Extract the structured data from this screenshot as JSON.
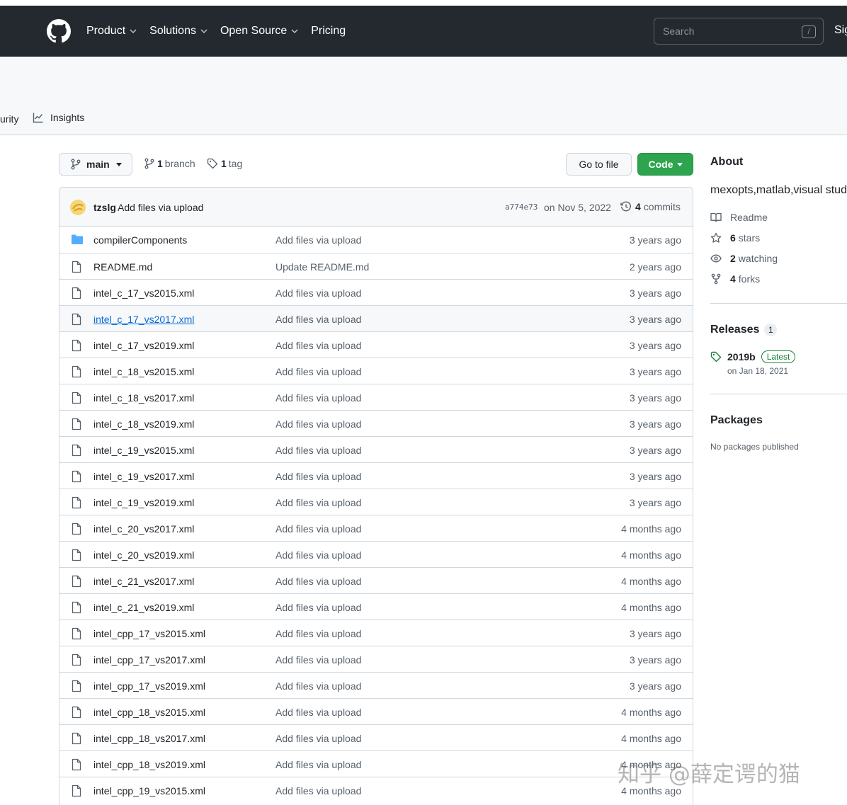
{
  "header": {
    "nav": [
      {
        "label": "Product",
        "has_menu": true
      },
      {
        "label": "Solutions",
        "has_menu": true
      },
      {
        "label": "Open Source",
        "has_menu": true
      },
      {
        "label": "Pricing",
        "has_menu": false
      }
    ],
    "search_placeholder": "Search",
    "search_shortcut": "/",
    "signin_label": "Sig"
  },
  "repo_tabs": {
    "security_partial": "urity",
    "insights": "Insights"
  },
  "toolbar": {
    "branch": "main",
    "branch_count": "1",
    "branch_label": "branch",
    "tag_count": "1",
    "tag_label": "tag",
    "goto_file": "Go to file",
    "code": "Code"
  },
  "latest_commit": {
    "author": "tzslg",
    "message": "Add files via upload",
    "sha": "a774e73",
    "date": "on Nov 5, 2022",
    "commit_count": "4",
    "commit_label": "commits"
  },
  "files": [
    {
      "type": "dir",
      "name": "compilerComponents",
      "message": "Add files via upload",
      "age": "3 years ago"
    },
    {
      "type": "file",
      "name": "README.md",
      "message": "Update README.md",
      "age": "2 years ago"
    },
    {
      "type": "file",
      "name": "intel_c_17_vs2015.xml",
      "message": "Add files via upload",
      "age": "3 years ago"
    },
    {
      "type": "file",
      "name": "intel_c_17_vs2017.xml",
      "message": "Add files via upload",
      "age": "3 years ago",
      "hover": true
    },
    {
      "type": "file",
      "name": "intel_c_17_vs2019.xml",
      "message": "Add files via upload",
      "age": "3 years ago"
    },
    {
      "type": "file",
      "name": "intel_c_18_vs2015.xml",
      "message": "Add files via upload",
      "age": "3 years ago"
    },
    {
      "type": "file",
      "name": "intel_c_18_vs2017.xml",
      "message": "Add files via upload",
      "age": "3 years ago"
    },
    {
      "type": "file",
      "name": "intel_c_18_vs2019.xml",
      "message": "Add files via upload",
      "age": "3 years ago"
    },
    {
      "type": "file",
      "name": "intel_c_19_vs2015.xml",
      "message": "Add files via upload",
      "age": "3 years ago"
    },
    {
      "type": "file",
      "name": "intel_c_19_vs2017.xml",
      "message": "Add files via upload",
      "age": "3 years ago"
    },
    {
      "type": "file",
      "name": "intel_c_19_vs2019.xml",
      "message": "Add files via upload",
      "age": "3 years ago"
    },
    {
      "type": "file",
      "name": "intel_c_20_vs2017.xml",
      "message": "Add files via upload",
      "age": "4 months ago"
    },
    {
      "type": "file",
      "name": "intel_c_20_vs2019.xml",
      "message": "Add files via upload",
      "age": "4 months ago"
    },
    {
      "type": "file",
      "name": "intel_c_21_vs2017.xml",
      "message": "Add files via upload",
      "age": "4 months ago"
    },
    {
      "type": "file",
      "name": "intel_c_21_vs2019.xml",
      "message": "Add files via upload",
      "age": "4 months ago"
    },
    {
      "type": "file",
      "name": "intel_cpp_17_vs2015.xml",
      "message": "Add files via upload",
      "age": "3 years ago"
    },
    {
      "type": "file",
      "name": "intel_cpp_17_vs2017.xml",
      "message": "Add files via upload",
      "age": "3 years ago"
    },
    {
      "type": "file",
      "name": "intel_cpp_17_vs2019.xml",
      "message": "Add files via upload",
      "age": "3 years ago"
    },
    {
      "type": "file",
      "name": "intel_cpp_18_vs2015.xml",
      "message": "Add files via upload",
      "age": "4 months ago"
    },
    {
      "type": "file",
      "name": "intel_cpp_18_vs2017.xml",
      "message": "Add files via upload",
      "age": "4 months ago"
    },
    {
      "type": "file",
      "name": "intel_cpp_18_vs2019.xml",
      "message": "Add files via upload",
      "age": "4 months ago"
    },
    {
      "type": "file",
      "name": "intel_cpp_19_vs2015.xml",
      "message": "Add files via upload",
      "age": "4 months ago"
    }
  ],
  "about": {
    "title": "About",
    "description": "mexopts,matlab,visual studi",
    "readme": "Readme",
    "stars_count": "6",
    "stars_label": "stars",
    "watching_count": "2",
    "watching_label": "watching",
    "forks_count": "4",
    "forks_label": "forks"
  },
  "releases": {
    "title": "Releases",
    "count": "1",
    "name": "2019b",
    "badge": "Latest",
    "date": "on Jan 18, 2021"
  },
  "packages": {
    "title": "Packages",
    "empty": "No packages published"
  },
  "watermark": "知乎 @薛定谔的猫",
  "colors": {
    "header_bg": "#24292f",
    "code_button": "#2da44e",
    "link": "#0969da",
    "folder_icon": "#54aeff"
  }
}
